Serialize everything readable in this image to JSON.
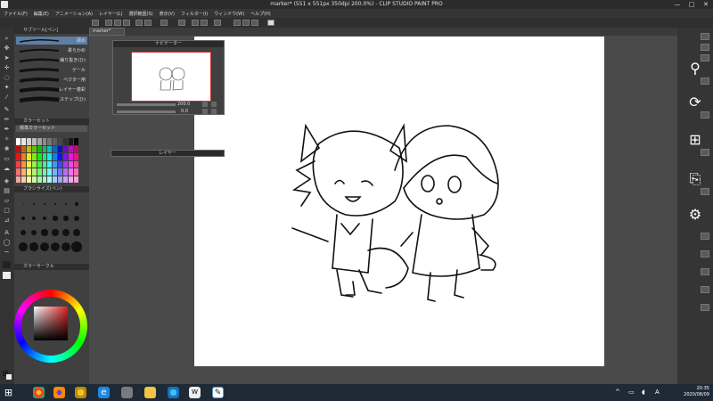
{
  "window": {
    "title": "marker* (551 x 551px 350dpi 200.0%) - CLIP STUDIO PAINT PRO",
    "controls": [
      "—",
      "□",
      "✕"
    ]
  },
  "menu": [
    "ファイル(F)",
    "編集(E)",
    "アニメーション(A)",
    "レイヤー(L)",
    "選択範囲(S)",
    "表示(V)",
    "フィルター(I)",
    "ウィンドウ(W)",
    "ヘルプ(H)"
  ],
  "document_tab": "marker*",
  "brush_panel": {
    "header": "サブツール[ペン]",
    "brushes": [
      "硬め",
      "柔らかめ",
      "繊り抜き(ひ)",
      "ゲール",
      "ベクター用",
      "レイヤー着彩",
      "ステップ(ひ)"
    ]
  },
  "color_set_panel": {
    "header": "カラーセット",
    "set_name": "標準カラーセット"
  },
  "brush_size_panel": {
    "header": "ブラシサイズ(ペン)",
    "sizes": [
      "0.7",
      "1",
      "1.5",
      "2",
      "2.5",
      "3",
      "4",
      "5",
      "6",
      "7",
      "8",
      "10",
      "12",
      "15",
      "17",
      "20",
      "25",
      "30",
      "40",
      "50",
      "60",
      "70",
      "80",
      "100"
    ]
  },
  "color_wheel_panel": {
    "header": "カラーサークル"
  },
  "navigator": {
    "header": "ナビゲーター",
    "zoom": "200.0",
    "rotation": "0.0"
  },
  "layer_panel": {
    "header": "レイヤー"
  },
  "taskbar": {
    "time": "20:35",
    "date": "2020/08/09",
    "apps": [
      "chrome",
      "firefox",
      "chrome-canary",
      "edge",
      "clip-studio-folder",
      "file-explorer",
      "edge-new",
      "wacom",
      "clip-studio-paint"
    ]
  },
  "colors": {
    "accent": "#5b9bd5",
    "canvas_bg": "#4a4a4a",
    "paper": "#ffffff"
  }
}
